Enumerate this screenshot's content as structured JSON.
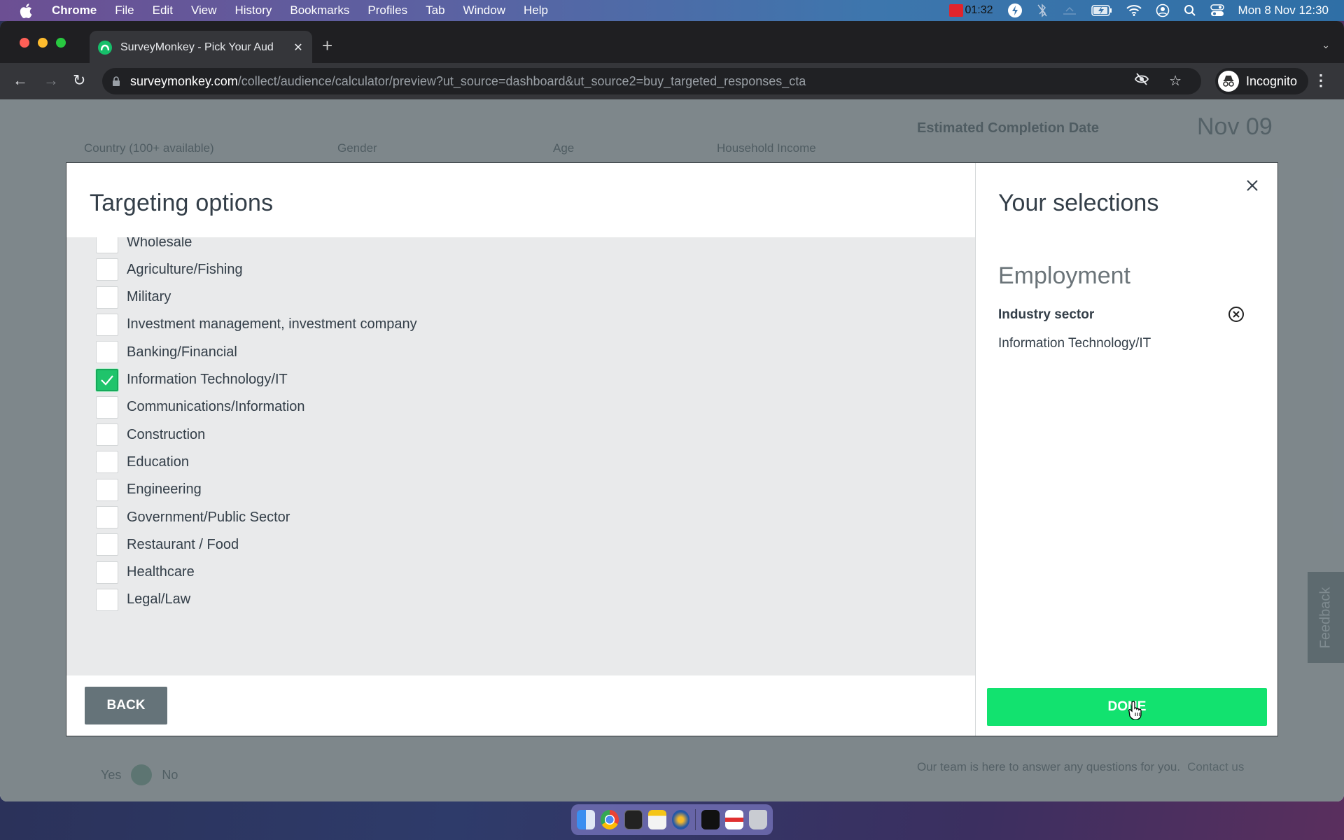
{
  "menubar": {
    "app": "Chrome",
    "items": [
      "File",
      "Edit",
      "View",
      "History",
      "Bookmarks",
      "Profiles",
      "Tab",
      "Window",
      "Help"
    ],
    "recording_time": "01:32",
    "clock": "Mon 8 Nov  12:30",
    "status_icons": [
      "flash-icon",
      "bluetooth-off-icon",
      "cloud-icon",
      "battery-charging-icon",
      "wifi-icon",
      "user-icon",
      "search-icon",
      "control-center-icon"
    ]
  },
  "browser": {
    "tab_title": "SurveyMonkey - Pick Your Aud",
    "url_host": "surveymonkey.com",
    "url_path": "/collect/audience/calculator/preview?ut_source=dashboard&ut_source2=buy_targeted_responses_cta",
    "profile_label": "Incognito"
  },
  "background_page": {
    "cards": [
      "Country (100+ available)",
      "Gender",
      "Age",
      "Household Income"
    ],
    "estimated_label": "Estimated Completion Date",
    "estimated_value": "Nov 09",
    "yes_label": "Yes",
    "no_label": "No",
    "help_text": "Our team is here to answer any questions for you.",
    "contact_link": "Contact us",
    "feedback_tab": "Feedback"
  },
  "modal": {
    "title": "Targeting options",
    "options": [
      {
        "label": "Wholesale",
        "checked": false
      },
      {
        "label": "Agriculture/Fishing",
        "checked": false
      },
      {
        "label": "Military",
        "checked": false
      },
      {
        "label": "Investment management, investment company",
        "checked": false
      },
      {
        "label": "Banking/Financial",
        "checked": false
      },
      {
        "label": "Information Technology/IT",
        "checked": true
      },
      {
        "label": "Communications/Information",
        "checked": false
      },
      {
        "label": "Construction",
        "checked": false
      },
      {
        "label": "Education",
        "checked": false
      },
      {
        "label": "Engineering",
        "checked": false
      },
      {
        "label": "Government/Public Sector",
        "checked": false
      },
      {
        "label": "Restaurant / Food",
        "checked": false
      },
      {
        "label": "Healthcare",
        "checked": false
      },
      {
        "label": "Legal/Law",
        "checked": false
      }
    ],
    "back_label": "BACK",
    "selections_title": "Your selections",
    "category": "Employment",
    "subcategory": "Industry sector",
    "selected_value": "Information Technology/IT",
    "done_label": "DONE",
    "accent_color": "#12e26f"
  }
}
